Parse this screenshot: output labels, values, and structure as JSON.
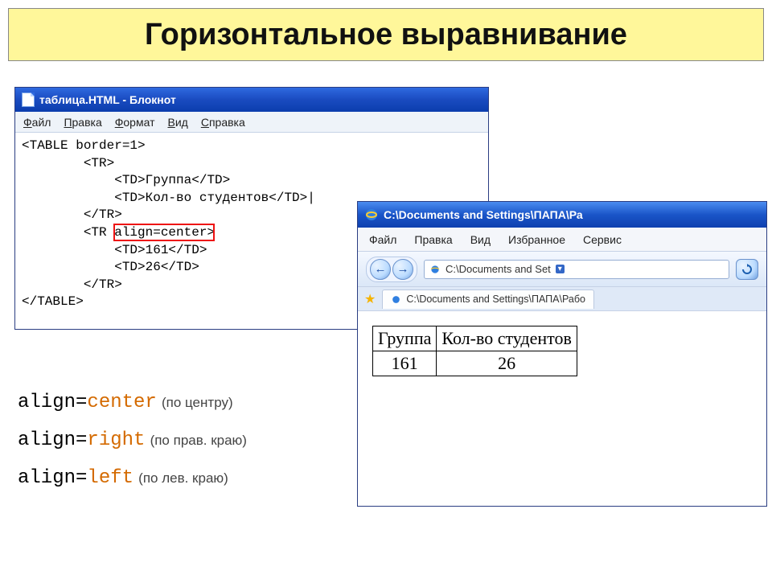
{
  "title": "Горизонтальное выравнивание",
  "notepad": {
    "window_title": "таблица.HTML - Блокнот",
    "menu": [
      "Файл",
      "Правка",
      "Формат",
      "Вид",
      "Справка"
    ],
    "code_lines": [
      "<TABLE border=1>",
      "        <TR>",
      "            <TD>Группа</TD>",
      "            <TD>Кол-во студентов</TD>|",
      "        </TR>",
      "        <TR align=center>",
      "            <TD>161</TD>",
      "            <TD>26</TD>",
      "        </TR>",
      "</TABLE>"
    ],
    "highlight_text": "align=center"
  },
  "ie": {
    "window_title": "C:\\Documents and Settings\\ПАПА\\Ра",
    "menu": [
      "Файл",
      "Правка",
      "Вид",
      "Избранное",
      "Сервис"
    ],
    "address_short": "C:\\Documents and Set",
    "tab_label": "C:\\Documents and Settings\\ПАПА\\Рабо",
    "table": {
      "headers": [
        "Группа",
        "Кол-во студентов"
      ],
      "row": [
        "161",
        "26"
      ]
    }
  },
  "legend": [
    {
      "key": "align=",
      "val": "center",
      "desc": "(по центру)"
    },
    {
      "key": "align=",
      "val": "right",
      "desc": "(по прав. краю)"
    },
    {
      "key": "align=",
      "val": "left",
      "desc": "(по лев. краю)"
    }
  ],
  "pager": ""
}
